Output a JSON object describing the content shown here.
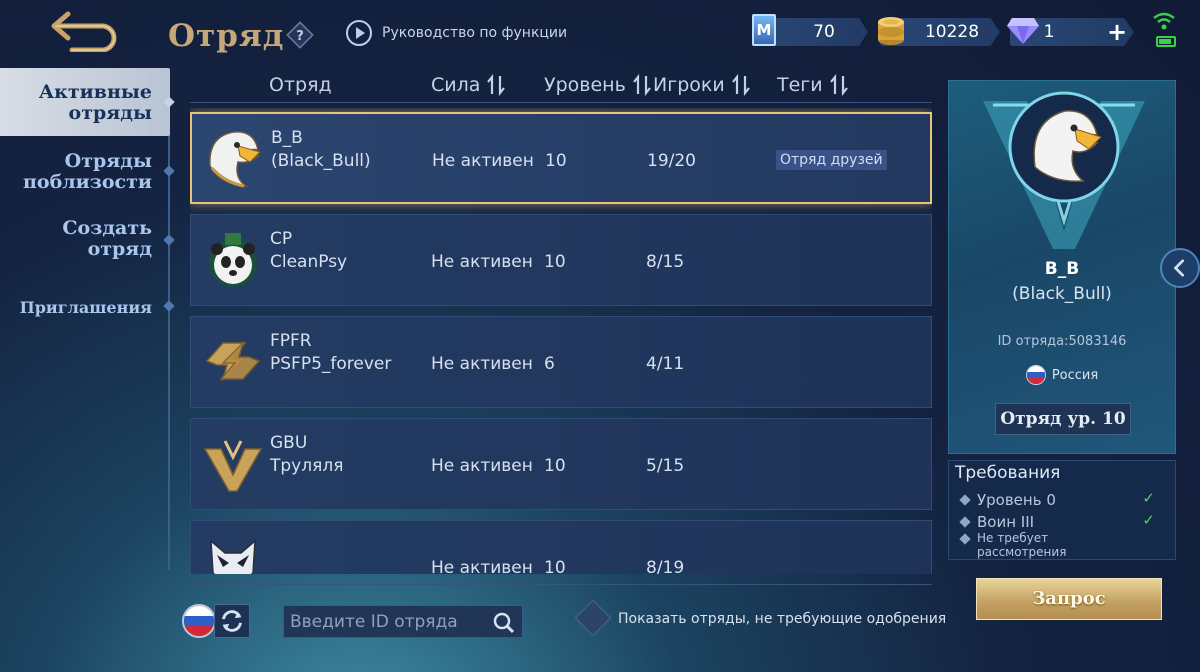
{
  "header": {
    "title": "Отряд",
    "help_icon": "question-icon",
    "guide_label": "Руководство по функции",
    "resources": {
      "m_currency": "70",
      "gold": "10228",
      "diamonds": "1"
    },
    "plus_label": "+"
  },
  "sidebar": {
    "items": [
      {
        "label": "Активные\nотряды",
        "active": true
      },
      {
        "label": "Отряды\nпоблизости"
      },
      {
        "label": "Создать\nотряд"
      },
      {
        "label": "Приглашения"
      }
    ]
  },
  "columns": {
    "squad": "Отряд",
    "power": "Сила",
    "level": "Уровень",
    "players": "Игроки",
    "tags": "Теги"
  },
  "rows": [
    {
      "tag": "B_B",
      "name": "(Black_Bull)",
      "status": "Не активен",
      "level": "10",
      "players": "19/20",
      "label": "Отряд друзей",
      "logo": "eagle-logo",
      "selected": true
    },
    {
      "tag": "CP",
      "name": "CleanPsy",
      "status": "Не активен",
      "level": "10",
      "players": "8/15",
      "label": "",
      "logo": "panda-logo"
    },
    {
      "tag": "FPFR",
      "name": "PSFP5_forever",
      "status": "Не активен",
      "level": "6",
      "players": "4/11",
      "label": "",
      "logo": "lightning-logo"
    },
    {
      "tag": "GBU",
      "name": "Труляля",
      "status": "Не активен",
      "level": "10",
      "players": "5/15",
      "label": "",
      "logo": "v-wing-logo"
    },
    {
      "tag": "",
      "name": "",
      "status": "Не активен",
      "level": "10",
      "players": "8/19",
      "label": "",
      "logo": "wolf-logo"
    }
  ],
  "footer": {
    "search_placeholder": "Введите ID отряда",
    "filter_label": "Показать отряды, не требующие одобрения"
  },
  "detail": {
    "tag": "B_B",
    "name": "(Black_Bull)",
    "id_text": "ID отряда:5083146",
    "country": "Россия",
    "level_badge": "Отряд ур. 10",
    "requirements_title": "Требования",
    "requirements": [
      {
        "text": "Уровень 0",
        "met": true
      },
      {
        "text": "Воин III",
        "met": true
      },
      {
        "text": "Не требует рассмотрения",
        "met": false
      }
    ],
    "check_mark": "✓",
    "request_label": "Запрос"
  },
  "colors": {
    "accent_gold": "#c5a779",
    "selected_border": "#e9c37c",
    "check_green": "#4bd35b"
  }
}
